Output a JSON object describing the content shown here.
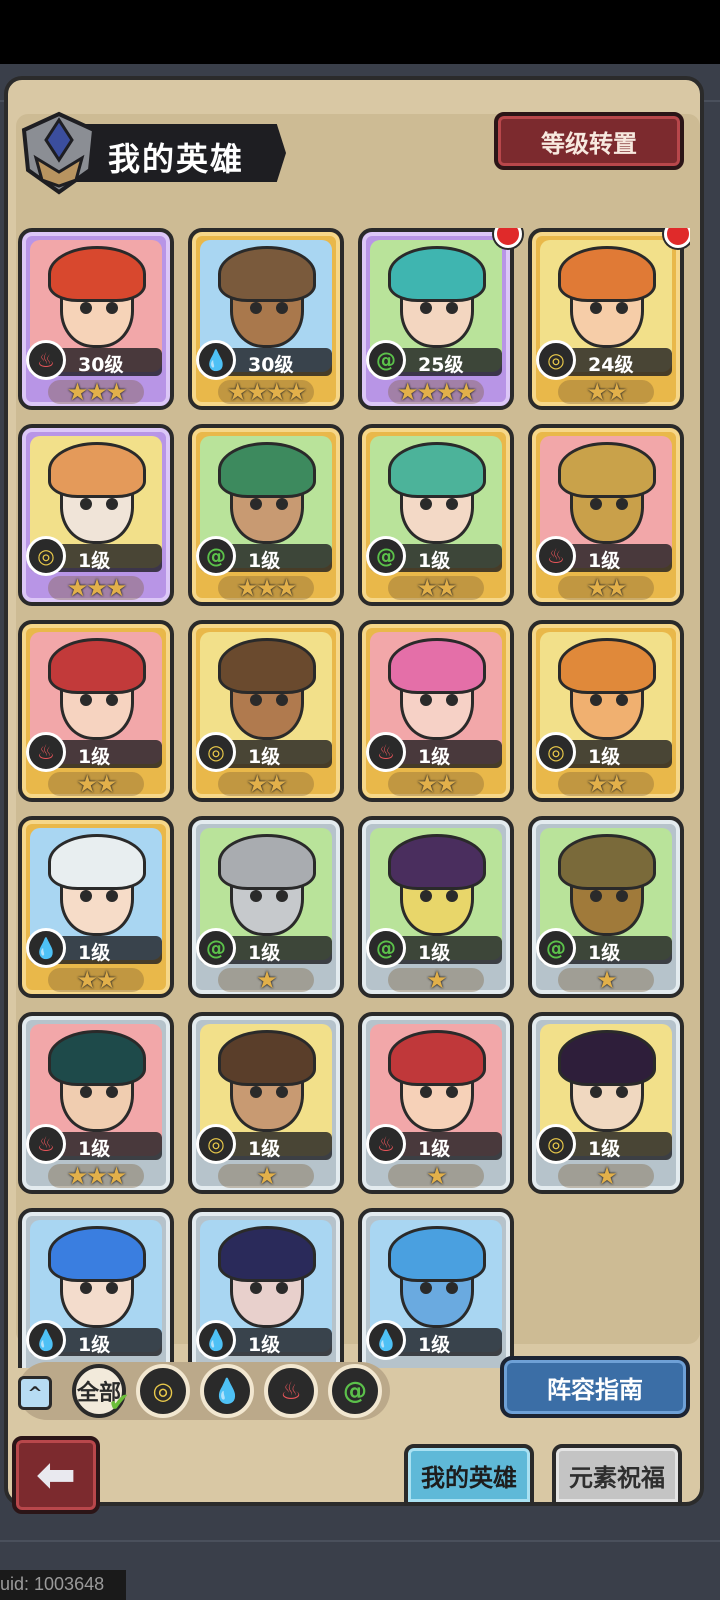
{
  "header": {
    "title": "我的英雄",
    "level_transfer_label": "等级转置"
  },
  "heroes": [
    {
      "level": "30级",
      "stars": "★★★",
      "element": "fire",
      "rarity": "purple",
      "notify": false
    },
    {
      "level": "30级",
      "stars": "★★★★",
      "element": "water",
      "rarity": "gold",
      "notify": false
    },
    {
      "level": "25级",
      "stars": "★★★★",
      "element": "wind",
      "rarity": "purple",
      "notify": true
    },
    {
      "level": "24级",
      "stars": "★★",
      "element": "earth",
      "rarity": "gold",
      "notify": true
    },
    {
      "level": "1级",
      "stars": "★★★",
      "element": "earth",
      "rarity": "purple",
      "notify": false
    },
    {
      "level": "1级",
      "stars": "★★★",
      "element": "wind",
      "rarity": "gold",
      "notify": false
    },
    {
      "level": "1级",
      "stars": "★★",
      "element": "wind",
      "rarity": "gold",
      "notify": false
    },
    {
      "level": "1级",
      "stars": "★★",
      "element": "fire",
      "rarity": "gold",
      "notify": false
    },
    {
      "level": "1级",
      "stars": "★★",
      "element": "fire",
      "rarity": "gold",
      "notify": false
    },
    {
      "level": "1级",
      "stars": "★★",
      "element": "earth",
      "rarity": "gold",
      "notify": false
    },
    {
      "level": "1级",
      "stars": "★★",
      "element": "fire",
      "rarity": "gold",
      "notify": false
    },
    {
      "level": "1级",
      "stars": "★★",
      "element": "earth",
      "rarity": "gold",
      "notify": false
    },
    {
      "level": "1级",
      "stars": "★★",
      "element": "water",
      "rarity": "gold",
      "notify": false
    },
    {
      "level": "1级",
      "stars": "★",
      "element": "wind",
      "rarity": "gray",
      "notify": false
    },
    {
      "level": "1级",
      "stars": "★",
      "element": "wind",
      "rarity": "gray",
      "notify": false
    },
    {
      "level": "1级",
      "stars": "★",
      "element": "wind",
      "rarity": "gray",
      "notify": false
    },
    {
      "level": "1级",
      "stars": "★★★",
      "element": "fire",
      "rarity": "gray",
      "notify": false
    },
    {
      "level": "1级",
      "stars": "★",
      "element": "earth",
      "rarity": "gray",
      "notify": false
    },
    {
      "level": "1级",
      "stars": "★",
      "element": "fire",
      "rarity": "gray",
      "notify": false
    },
    {
      "level": "1级",
      "stars": "★",
      "element": "earth",
      "rarity": "gray",
      "notify": false
    },
    {
      "level": "1级",
      "stars": "",
      "element": "water",
      "rarity": "gray",
      "notify": false
    },
    {
      "level": "1级",
      "stars": "",
      "element": "water",
      "rarity": "gray",
      "notify": false
    },
    {
      "level": "1级",
      "stars": "",
      "element": "water",
      "rarity": "gray",
      "notify": false
    }
  ],
  "filters": {
    "collapse_icon": "^",
    "all_label": "全部",
    "elements": [
      "earth",
      "water",
      "fire",
      "wind"
    ]
  },
  "lineup_guide_label": "阵容指南",
  "tabs": [
    {
      "label": "我的英雄",
      "active": true
    },
    {
      "label": "元素祝福",
      "active": false
    }
  ],
  "uid_text": "uid: 1003648",
  "colors": {
    "fire": "#e8555a",
    "water": "#56a8e8",
    "wind": "#5bc04a",
    "earth": "#e8c84a"
  }
}
